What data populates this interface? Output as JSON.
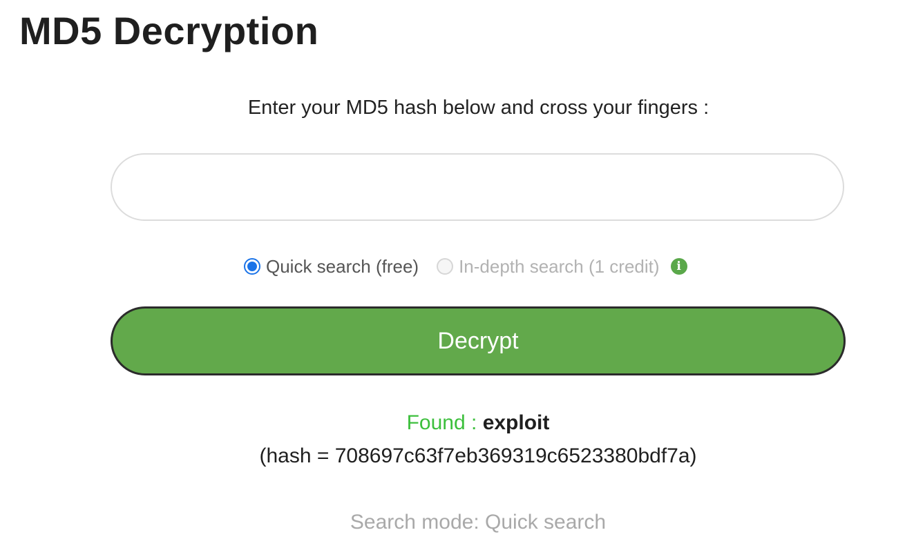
{
  "page": {
    "title": "MD5 Decryption",
    "instruction": "Enter your MD5 hash below and cross your fingers :"
  },
  "form": {
    "hash_value": "",
    "options": {
      "quick": {
        "label": "Quick search (free)",
        "checked": true,
        "disabled": false
      },
      "in_depth": {
        "label": "In-depth search (1 credit)",
        "checked": false,
        "disabled": true
      }
    },
    "info_icon": "info-circle-icon",
    "decrypt_label": "Decrypt"
  },
  "result": {
    "found_label": "Found :",
    "found_value": "exploit",
    "hash_line": "(hash = 708697c63f7eb369319c6523380bdf7a)",
    "search_mode": "Search mode: Quick search"
  },
  "colors": {
    "button_green": "#62a94b",
    "found_green": "#3cbf3c",
    "radio_blue": "#1a73e8",
    "info_green": "#5aa84a"
  }
}
